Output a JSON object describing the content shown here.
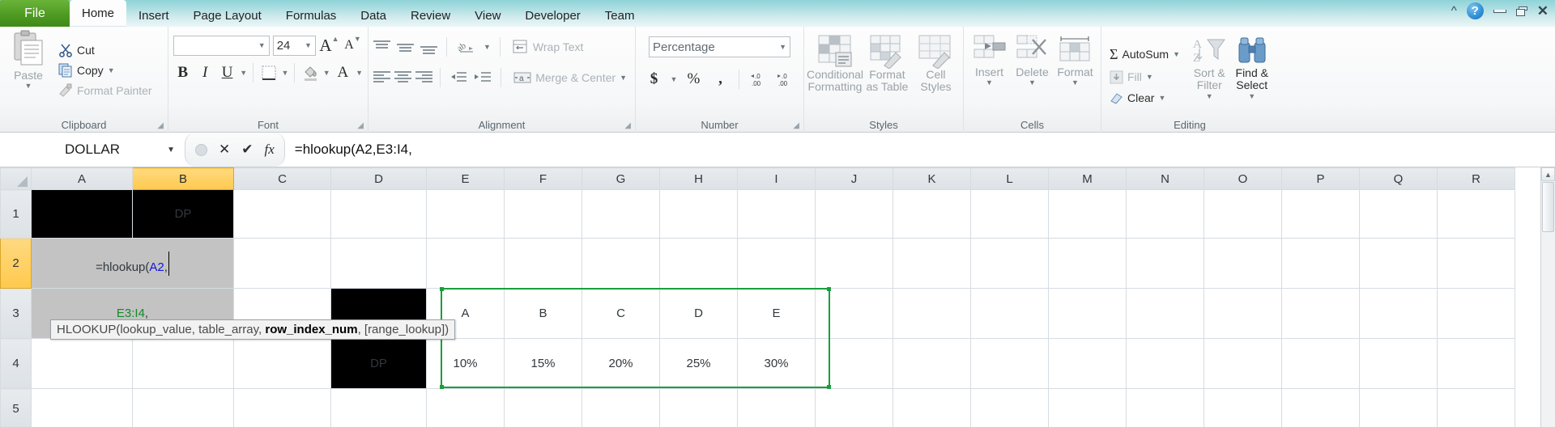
{
  "window": {
    "tabs": [
      "File",
      "Home",
      "Insert",
      "Page Layout",
      "Formulas",
      "Data",
      "Review",
      "View",
      "Developer",
      "Team"
    ],
    "active_tab": "Home",
    "controls": {
      "collapse_ribbon": "collapse-ribbon-icon",
      "help": "?",
      "minimize": "minimize-icon",
      "restore": "restore-icon",
      "close": "close-icon"
    }
  },
  "ribbon": {
    "clipboard": {
      "title": "Clipboard",
      "paste": "Paste",
      "cut": "Cut",
      "copy": "Copy",
      "format_painter": "Format Painter"
    },
    "font": {
      "title": "Font",
      "font_name_value": "",
      "font_name_placeholder": "",
      "font_size_value": "24",
      "grow_font": "A",
      "shrink_font": "A",
      "bold": "B",
      "italic": "I",
      "underline": "U",
      "borders": "borders-icon",
      "fill_color": "fill-color-icon",
      "font_color": "A"
    },
    "alignment": {
      "title": "Alignment",
      "wrap_text": "Wrap Text",
      "merge_center": "Merge & Center"
    },
    "number": {
      "title": "Number",
      "format_value": "Percentage",
      "currency": "$",
      "percent": "%",
      "comma": ",",
      "increase_decimal": "increase-decimal-icon",
      "decrease_decimal": "decrease-decimal-icon"
    },
    "styles": {
      "title": "Styles",
      "conditional_formatting": "Conditional Formatting",
      "format_as_table": "Format as Table",
      "cell_styles": "Cell Styles"
    },
    "cells": {
      "title": "Cells",
      "insert": "Insert",
      "delete": "Delete",
      "format": "Format"
    },
    "editing": {
      "title": "Editing",
      "autosum": "AutoSum",
      "fill": "Fill",
      "clear": "Clear",
      "sort_filter": "Sort & Filter",
      "find_select": "Find & Select"
    }
  },
  "formula_bar": {
    "name_box_value": "DOLLAR",
    "cancel": "✕",
    "enter": "✔",
    "insert_function": "fx",
    "formula_value": "=hlookup(A2,E3:I4,"
  },
  "grid": {
    "column_headers": [
      "A",
      "B",
      "C",
      "D",
      "E",
      "F",
      "G",
      "H",
      "I",
      "J",
      "K",
      "L",
      "M",
      "N",
      "O",
      "P",
      "Q",
      "R"
    ],
    "selected_column": "B",
    "row_headers": [
      "1",
      "2",
      "3",
      "4",
      "5"
    ],
    "selected_row": "2",
    "cells": {
      "b1": "DP",
      "b2_formula_part1": "=hlookup(",
      "b2_formula_arg1": "A2",
      "b2_formula_sep1": ",",
      "b2_formula_arg2": "E3:I4",
      "b2_formula_sep2": ",",
      "d3": "",
      "d4": "DP",
      "header_row": [
        "A",
        "B",
        "C",
        "D",
        "E"
      ],
      "value_row": [
        "10%",
        "15%",
        "20%",
        "25%",
        "30%"
      ]
    },
    "selection_range": "E3:I4"
  },
  "tooltip": {
    "prefix": "HLOOKUP(lookup_value, table_array, ",
    "bold": "row_index_num",
    "suffix": ", [range_lookup])"
  },
  "colors": {
    "file_tab_green": "#4f9b22",
    "title_bar_teal": "#a9dde0",
    "selected_header": "#ffc94d",
    "selection_border": "#1a9e3c",
    "formula_arg_blue": "#1414d6",
    "formula_arg_green": "#128a28"
  }
}
